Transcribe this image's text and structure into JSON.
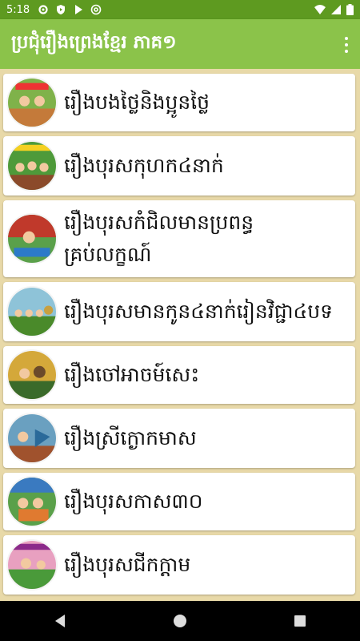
{
  "status_bar": {
    "time": "5:18"
  },
  "app_bar": {
    "title": "ប្រជុំរឿងព្រេងខ្មែរ ភាគ១"
  },
  "stories": [
    {
      "title": "រឿងបងថ្លៃនិងប្អូនថ្លៃ",
      "thumb_colors": [
        "#7fb24a",
        "#c47a3a"
      ]
    },
    {
      "title": "រឿងបុរសកុហក៤នាក់",
      "thumb_colors": [
        "#4e9a3a",
        "#8b4a2a"
      ]
    },
    {
      "title_lines": [
        "រឿងបុរសកំជិលមានប្រពន្ធ",
        "គ្រប់លក្ខណ៍"
      ],
      "thumb_colors": [
        "#c0392b",
        "#5aa04a"
      ]
    },
    {
      "title": "រឿងបុរសមានកូន៤នាក់រៀនវិជ្ជា៤បទ",
      "thumb_colors": [
        "#8ec3d8",
        "#4a8a2a"
      ]
    },
    {
      "title": "រឿងចៅអាចម៍សេះ",
      "thumb_colors": [
        "#d4a83a",
        "#3a6a2a"
      ]
    },
    {
      "title": "រឿងស្រីក្ងោកមាស",
      "thumb_colors": [
        "#6aa0c0",
        "#a0522d"
      ]
    },
    {
      "title": "រឿងបុរសកាស៣០",
      "thumb_colors": [
        "#5aa04a",
        "#3a7ac0"
      ]
    },
    {
      "title": "រឿងបុរសជីកក្តាម",
      "thumb_colors": [
        "#e8a0c0",
        "#4a9a3a"
      ]
    }
  ]
}
